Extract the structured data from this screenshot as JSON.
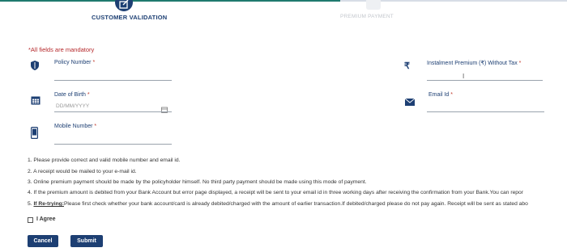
{
  "stepper": {
    "steps": [
      {
        "label": "CUSTOMER VALIDATION",
        "state": "active"
      },
      {
        "label": "PREMIUM PAYMENT",
        "state": "inactive"
      }
    ],
    "active_color": "#1d3f73"
  },
  "mandatory_note": "*All fields are mandatory",
  "fields": {
    "policy_number": {
      "label": "Policy Number",
      "req": " *",
      "icon": "shield-icon"
    },
    "installment_premium": {
      "label": "Instalment Premium (₹) Without Tax",
      "req": " *",
      "icon": "rupee-icon"
    },
    "dob": {
      "label": "Date of Birth",
      "req": " *",
      "placeholder": "DD/MM/YYYY",
      "icon": "calendar-icon"
    },
    "email": {
      "label": "Email Id",
      "req": " *",
      "icon": "envelope-icon"
    },
    "mobile": {
      "label": "Mobile Number",
      "req": " *",
      "icon": "mobile-phone-icon"
    }
  },
  "notes": [
    "1. Please provide correct and valid mobile number and email id.",
    "2. A receipt would be mailed to your e-mail id.",
    "3. Online premium payment should be made by the policyholder himself. No third party payment should be made using this mode of payment.",
    "4. If the premium amount is debited from your Bank Account but error page displayed, a receipt will be sent to your email id in three working days after receiving the confirmation from your Bank.You can repor",
    {
      "prefix": "5. ",
      "bold": "If Re-trying:",
      "text": "Please first check whether your bank account/card is already debited/charged with the amount of earlier transaction.If debited/charged please do not pay again. Receipt will be sent as stated abo"
    }
  ],
  "agree_label": "I Agree",
  "buttons": {
    "cancel": "Cancel",
    "submit": "Submit"
  }
}
